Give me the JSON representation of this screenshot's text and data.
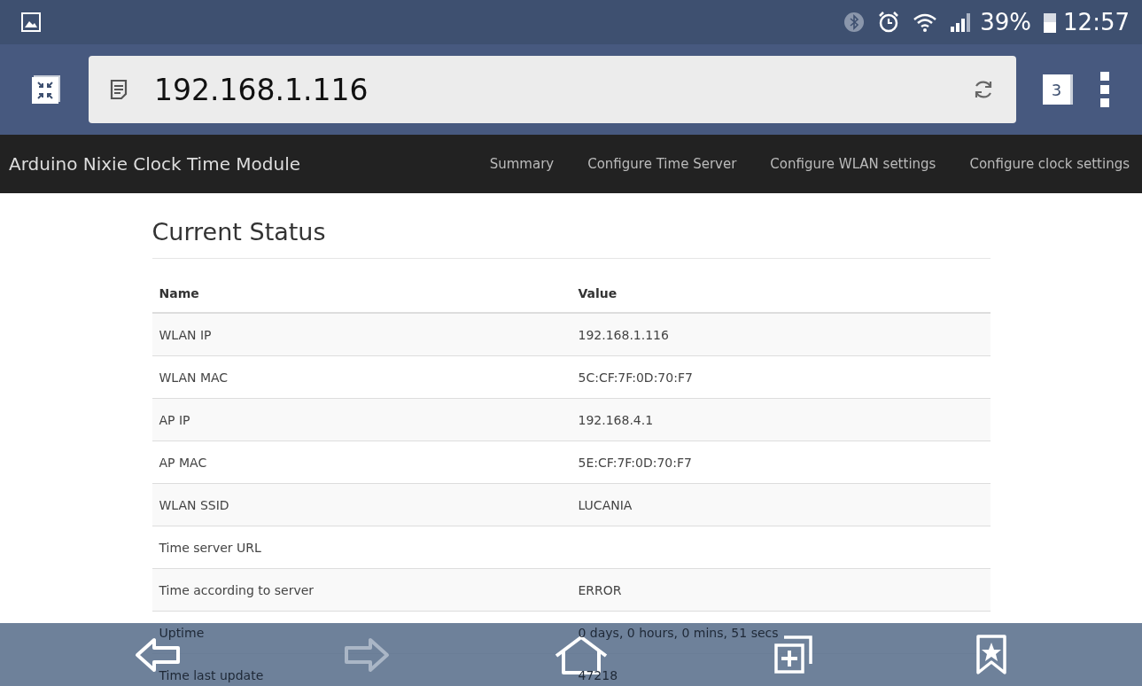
{
  "status_bar": {
    "battery": "39%",
    "time": "12:57"
  },
  "browser": {
    "url": "192.168.1.116",
    "tab_count": "3"
  },
  "navbar": {
    "brand": "Arduino Nixie Clock Time Module",
    "links": [
      {
        "label": "Summary"
      },
      {
        "label": "Configure Time Server"
      },
      {
        "label": "Configure WLAN settings"
      },
      {
        "label": "Configure clock settings"
      }
    ]
  },
  "heading": "Current Status",
  "table": {
    "columns": [
      "Name",
      "Value"
    ],
    "rows": [
      [
        "WLAN IP",
        "192.168.1.116"
      ],
      [
        "WLAN MAC",
        "5C:CF:7F:0D:70:F7"
      ],
      [
        "AP IP",
        "192.168.4.1"
      ],
      [
        "AP MAC",
        "5E:CF:7F:0D:70:F7"
      ],
      [
        "WLAN SSID",
        "LUCANIA"
      ],
      [
        "Time server URL",
        ""
      ],
      [
        "Time according to server",
        "ERROR"
      ],
      [
        "Uptime",
        "0 days, 0 hours, 0 mins, 51 secs"
      ],
      [
        "Time last update",
        "47218"
      ]
    ]
  },
  "bottom_bar": {
    "forward_disabled": true
  }
}
